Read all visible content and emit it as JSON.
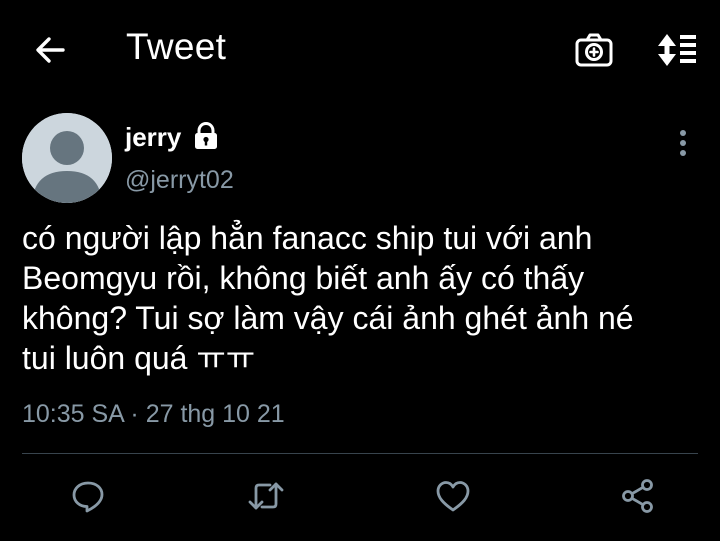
{
  "header": {
    "title": "Tweet",
    "icons": {
      "back": "arrow-left-icon",
      "camera": "camera-icon",
      "sort": "sort-icon"
    }
  },
  "tweet": {
    "display_name": "jerry",
    "protected": true,
    "handle": "@jerryt02",
    "text": "có người lập hẳn fanacc ship tui với anh\nBeomgyu rồi, không biết anh ấy có thấy\nkhông? Tui sợ làm vậy cái ảnh ghét ảnh né\ntui luôn quá ㅠㅠ",
    "timestamp": "10:35 SA · 27 thg 10 21"
  },
  "actions": [
    "reply-icon",
    "retweet-icon",
    "like-icon",
    "share-icon"
  ],
  "colors": {
    "background": "#000000",
    "text_primary": "#ffffff",
    "text_secondary": "#8899a6",
    "divider": "#38444d",
    "avatar_bg": "#ccd6dd",
    "avatar_fg": "#66757f"
  }
}
